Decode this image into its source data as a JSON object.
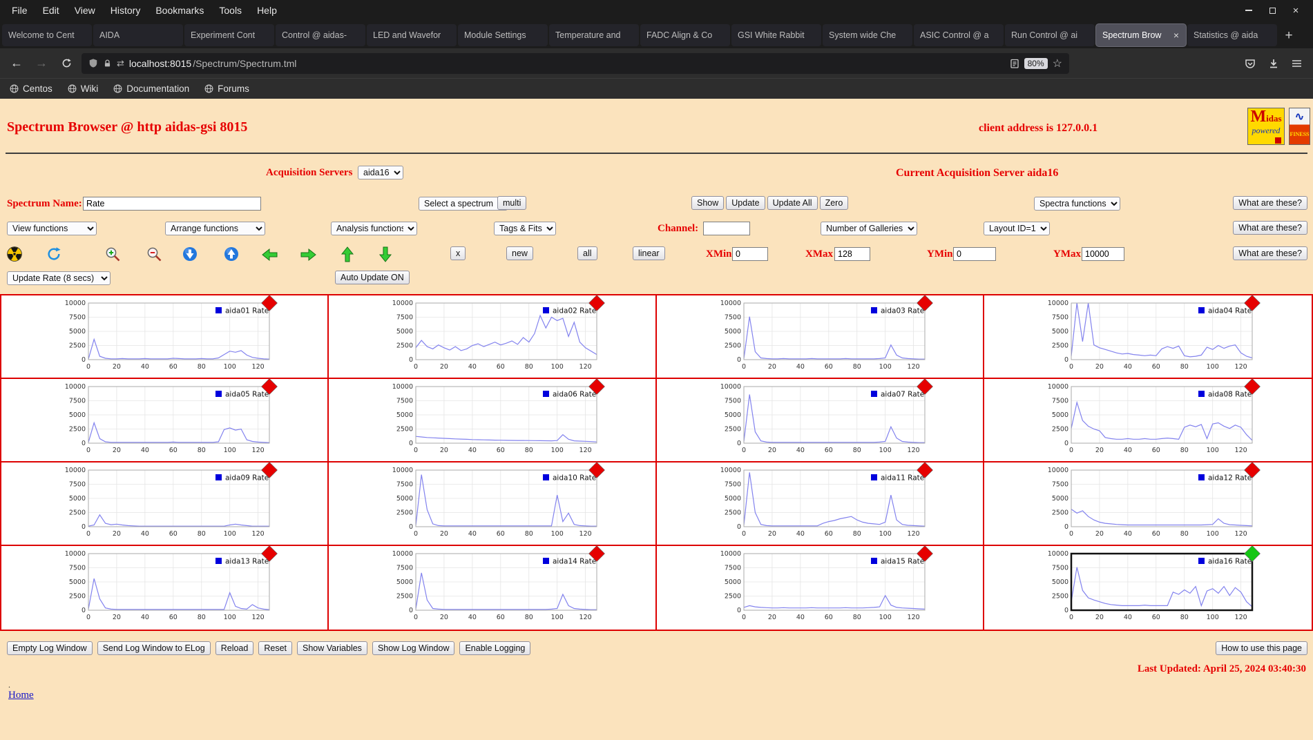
{
  "browser": {
    "menubar": {
      "items": [
        "File",
        "Edit",
        "View",
        "History",
        "Bookmarks",
        "Tools",
        "Help"
      ]
    },
    "tabs": [
      {
        "label": "Welcome to Cent"
      },
      {
        "label": "AIDA"
      },
      {
        "label": "Experiment Cont"
      },
      {
        "label": "Control @ aidas-"
      },
      {
        "label": "LED and Wavefor"
      },
      {
        "label": "Module Settings"
      },
      {
        "label": "Temperature and"
      },
      {
        "label": "FADC Align & Co"
      },
      {
        "label": "GSI White Rabbit"
      },
      {
        "label": "System wide Che"
      },
      {
        "label": "ASIC Control @ a"
      },
      {
        "label": "Run Control @ ai"
      },
      {
        "label": "Spectrum Brow",
        "active": true,
        "closable": true
      },
      {
        "label": "Statistics @ aida"
      }
    ],
    "new_tab_button": "+",
    "nav": {
      "url_host": "localhost:8015",
      "url_path": "/Spectrum/Spectrum.tml",
      "zoom": "80%"
    },
    "bookmarks": [
      "Centos",
      "Wiki",
      "Documentation",
      "Forums"
    ]
  },
  "header": {
    "title": "Spectrum Browser @ http aidas-gsi 8015",
    "client_address": "client address is 127.0.0.1"
  },
  "acquisition": {
    "label": "Acquisition Servers",
    "selected": "aida16",
    "current": "Current Acquisition Server aida16"
  },
  "controls": {
    "spectrum_name_label": "Spectrum Name:",
    "spectrum_name_value": "Rate",
    "select_spectrum": "Select a spectrum",
    "multi": "multi",
    "show": "Show",
    "update": "Update",
    "update_all": "Update All",
    "zero": "Zero",
    "spectra_functions": "Spectra functions",
    "what_are_these": "What are these?",
    "view_functions": "View functions",
    "arrange_functions": "Arrange functions",
    "analysis_functions": "Analysis functions",
    "tags_fits": "Tags & Fits",
    "channel_label": "Channel:",
    "channel_value": "",
    "number_of_galleries": "Number of Galleries",
    "layout_id": "Layout ID=1",
    "x_btn": "x",
    "new_btn": "new",
    "all_btn": "all",
    "linear_btn": "linear",
    "xmin_label": "XMin",
    "xmin": "0",
    "xmax_label": "XMax",
    "xmax": "128",
    "ymin_label": "YMin",
    "ymin": "0",
    "ymax_label": "YMax",
    "ymax": "10000",
    "update_rate": "Update Rate (8 secs)",
    "auto_update": "Auto Update ON"
  },
  "footer": {
    "buttons": [
      "Empty Log Window",
      "Send Log Window to ELog",
      "Reload",
      "Reset",
      "Show Variables",
      "Show Log Window",
      "Enable Logging"
    ],
    "help_button": "How to use this page",
    "last_updated": "Last Updated: April 25, 2024 03:40:30",
    "dot": ".",
    "home": "Home"
  },
  "chart_data": {
    "type": "line",
    "x_start": 0,
    "x_step": 4,
    "xlim": [
      0,
      128
    ],
    "ylim": [
      0,
      10000
    ],
    "x_ticks": [
      0,
      20,
      40,
      60,
      80,
      100,
      120
    ],
    "y_ticks": [
      0,
      2500,
      5000,
      7500,
      10000
    ],
    "line_color": "#8282ee",
    "legend_square_color": "#0000dd",
    "marker_red": "#e60000",
    "marker_green": "#15c615",
    "series": [
      {
        "name": "aida01 Rate",
        "marker": "red",
        "values": [
          100,
          3600,
          600,
          250,
          150,
          150,
          200,
          150,
          150,
          150,
          200,
          150,
          150,
          150,
          150,
          250,
          200,
          150,
          150,
          150,
          200,
          150,
          150,
          300,
          900,
          1500,
          1300,
          1600,
          800,
          400,
          250,
          150,
          100
        ]
      },
      {
        "name": "aida02 Rate",
        "marker": "red",
        "values": [
          2100,
          3400,
          2300,
          1900,
          2600,
          2100,
          1700,
          2300,
          1600,
          1900,
          2500,
          2800,
          2300,
          2700,
          3100,
          2600,
          2900,
          3300,
          2700,
          3900,
          3100,
          4600,
          7800,
          5600,
          7500,
          6900,
          7300,
          4100,
          6600,
          3100,
          2100,
          1500,
          900
        ]
      },
      {
        "name": "aida03 Rate",
        "marker": "red",
        "values": [
          200,
          7600,
          1400,
          300,
          200,
          150,
          150,
          200,
          150,
          150,
          150,
          150,
          200,
          150,
          150,
          150,
          150,
          150,
          200,
          150,
          150,
          150,
          150,
          150,
          200,
          300,
          2600,
          800,
          300,
          200,
          150,
          100,
          100
        ]
      },
      {
        "name": "aida04 Rate",
        "marker": "red",
        "values": [
          600,
          10000,
          3200,
          10000,
          2600,
          2100,
          1800,
          1500,
          1200,
          1000,
          1100,
          900,
          800,
          700,
          800,
          700,
          1900,
          2300,
          2000,
          2400,
          700,
          500,
          600,
          800,
          2200,
          1800,
          2500,
          2000,
          2400,
          2600,
          1200,
          600,
          300
        ]
      },
      {
        "name": "aida05 Rate",
        "marker": "red",
        "values": [
          150,
          3600,
          800,
          250,
          150,
          150,
          150,
          150,
          150,
          150,
          150,
          150,
          150,
          150,
          150,
          200,
          150,
          150,
          150,
          150,
          150,
          150,
          150,
          250,
          2400,
          2700,
          2300,
          2500,
          600,
          300,
          200,
          150,
          100
        ]
      },
      {
        "name": "aida06 Rate",
        "marker": "red",
        "values": [
          1200,
          1100,
          1000,
          950,
          900,
          850,
          800,
          760,
          720,
          680,
          640,
          610,
          580,
          560,
          540,
          520,
          500,
          490,
          480,
          470,
          460,
          450,
          440,
          430,
          420,
          460,
          1500,
          700,
          420,
          370,
          330,
          280,
          220
        ]
      },
      {
        "name": "aida07 Rate",
        "marker": "red",
        "values": [
          300,
          8600,
          2000,
          400,
          200,
          150,
          150,
          150,
          150,
          150,
          150,
          150,
          150,
          150,
          150,
          150,
          150,
          150,
          150,
          150,
          150,
          150,
          150,
          150,
          200,
          300,
          2900,
          900,
          300,
          200,
          150,
          100,
          100
        ]
      },
      {
        "name": "aida08 Rate",
        "marker": "red",
        "values": [
          2600,
          7200,
          4000,
          3000,
          2500,
          2200,
          1000,
          800,
          700,
          700,
          800,
          700,
          700,
          800,
          700,
          700,
          800,
          900,
          800,
          700,
          2800,
          3200,
          2900,
          3300,
          800,
          3400,
          3600,
          3000,
          2600,
          3200,
          2800,
          1500,
          500
        ]
      },
      {
        "name": "aida09 Rate",
        "marker": "red",
        "values": [
          100,
          300,
          2100,
          600,
          350,
          450,
          300,
          200,
          150,
          100,
          100,
          100,
          100,
          100,
          100,
          100,
          100,
          100,
          100,
          100,
          100,
          100,
          100,
          100,
          100,
          300,
          450,
          300,
          200,
          100,
          100,
          100,
          100
        ]
      },
      {
        "name": "aida10 Rate",
        "marker": "red",
        "values": [
          200,
          9200,
          3000,
          500,
          200,
          150,
          150,
          150,
          150,
          150,
          150,
          150,
          150,
          150,
          150,
          150,
          150,
          150,
          150,
          150,
          150,
          150,
          150,
          150,
          150,
          5600,
          900,
          2400,
          400,
          200,
          150,
          100,
          100
        ]
      },
      {
        "name": "aida11 Rate",
        "marker": "red",
        "values": [
          300,
          9600,
          2500,
          400,
          200,
          150,
          150,
          150,
          150,
          150,
          150,
          150,
          150,
          150,
          600,
          900,
          1100,
          1400,
          1600,
          1800,
          1200,
          800,
          600,
          500,
          400,
          800,
          5600,
          1200,
          400,
          250,
          200,
          150,
          100
        ]
      },
      {
        "name": "aida12 Rate",
        "marker": "red",
        "values": [
          3100,
          2400,
          2800,
          1800,
          1200,
          800,
          600,
          500,
          400,
          350,
          300,
          300,
          300,
          300,
          300,
          300,
          300,
          300,
          300,
          300,
          300,
          300,
          300,
          300,
          350,
          400,
          1400,
          600,
          350,
          300,
          250,
          200,
          150
        ]
      },
      {
        "name": "aida13 Rate",
        "marker": "red",
        "values": [
          200,
          5600,
          2000,
          400,
          200,
          150,
          150,
          150,
          150,
          150,
          150,
          150,
          150,
          150,
          150,
          150,
          150,
          150,
          150,
          150,
          150,
          150,
          150,
          150,
          150,
          3100,
          700,
          300,
          200,
          1000,
          400,
          200,
          100
        ]
      },
      {
        "name": "aida14 Rate",
        "marker": "red",
        "values": [
          200,
          6600,
          1800,
          300,
          200,
          150,
          150,
          150,
          150,
          150,
          150,
          150,
          150,
          150,
          150,
          150,
          150,
          150,
          150,
          150,
          150,
          150,
          150,
          150,
          200,
          300,
          2800,
          800,
          300,
          200,
          150,
          100,
          100
        ]
      },
      {
        "name": "aida15 Rate",
        "marker": "red",
        "values": [
          500,
          800,
          600,
          500,
          450,
          400,
          400,
          450,
          400,
          400,
          400,
          400,
          450,
          400,
          400,
          400,
          400,
          400,
          450,
          400,
          400,
          400,
          450,
          500,
          600,
          2600,
          900,
          500,
          400,
          350,
          300,
          250,
          200
        ]
      },
      {
        "name": "aida16 Rate",
        "marker": "green",
        "selected": true,
        "values": [
          1500,
          7600,
          3500,
          2200,
          1800,
          1500,
          1200,
          1000,
          900,
          800,
          800,
          800,
          800,
          900,
          800,
          800,
          800,
          800,
          3200,
          2800,
          3600,
          3000,
          4200,
          800,
          3400,
          3800,
          3000,
          4200,
          2600,
          4000,
          3200,
          1500,
          600
        ]
      }
    ]
  }
}
